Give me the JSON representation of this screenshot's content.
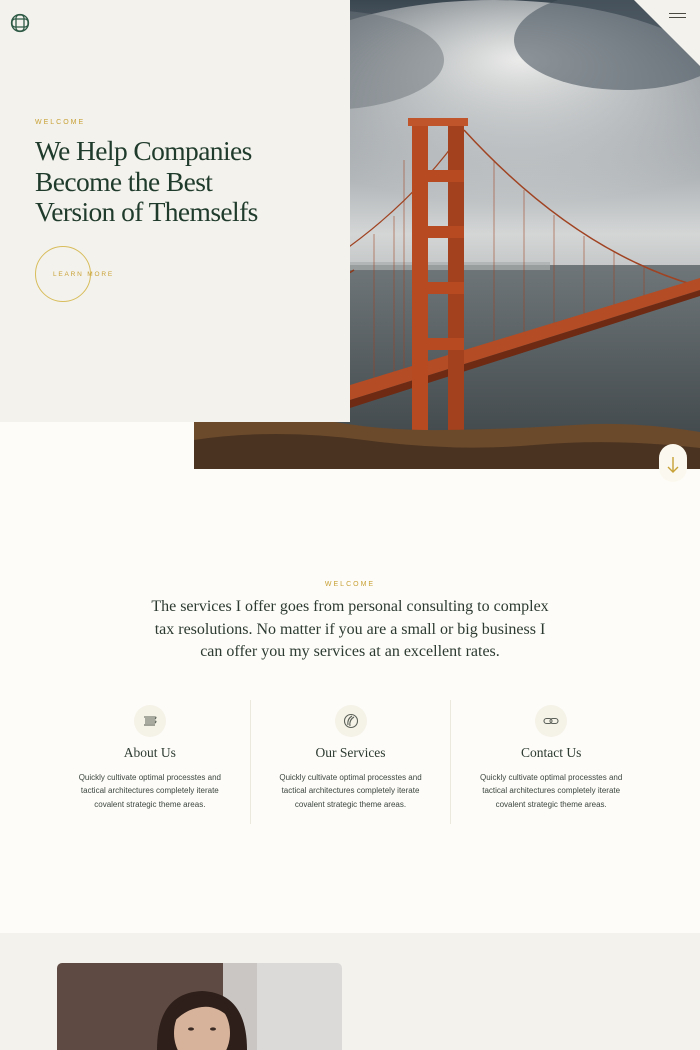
{
  "header": {
    "logo_icon": "logo-knot-icon",
    "menu_icon": "hamburger-icon"
  },
  "hero": {
    "eyebrow": "WELCOME",
    "title_lines": [
      "We Help Companies",
      "Become the Best",
      "Version of Themselfs"
    ],
    "cta_label": "LEARN MORE",
    "scroll_icon": "arrow-down-icon",
    "image": "golden-gate-bridge-photo"
  },
  "intro": {
    "eyebrow": "WELCOME",
    "text_lines": [
      "The services I offer goes from personal consulting to complex",
      "tax resolutions. No matter if you are a small or big business I",
      "can offer you my services at an excellent rates."
    ]
  },
  "features": [
    {
      "icon": "stack-lines-icon",
      "title": "About Us",
      "desc_lines": [
        "Quickly cultivate optimal processtes and",
        "tactical architectures completely iterate",
        "covalent strategic theme areas."
      ]
    },
    {
      "icon": "swirl-circle-icon",
      "title": "Our Services",
      "desc_lines": [
        "Quickly cultivate optimal processtes and",
        "tactical architectures completely iterate",
        "covalent strategic theme areas."
      ]
    },
    {
      "icon": "chain-link-icon",
      "title": "Contact Us",
      "desc_lines": [
        "Quickly cultivate optimal processtes and",
        "tactical architectures completely iterate",
        "covalent strategic theme areas."
      ]
    }
  ],
  "colors": {
    "accent_gold": "#c7a136",
    "heading_green": "#1f3b2b",
    "panel_beige": "#f4f2ec",
    "page_bg": "#fdfcf8"
  }
}
